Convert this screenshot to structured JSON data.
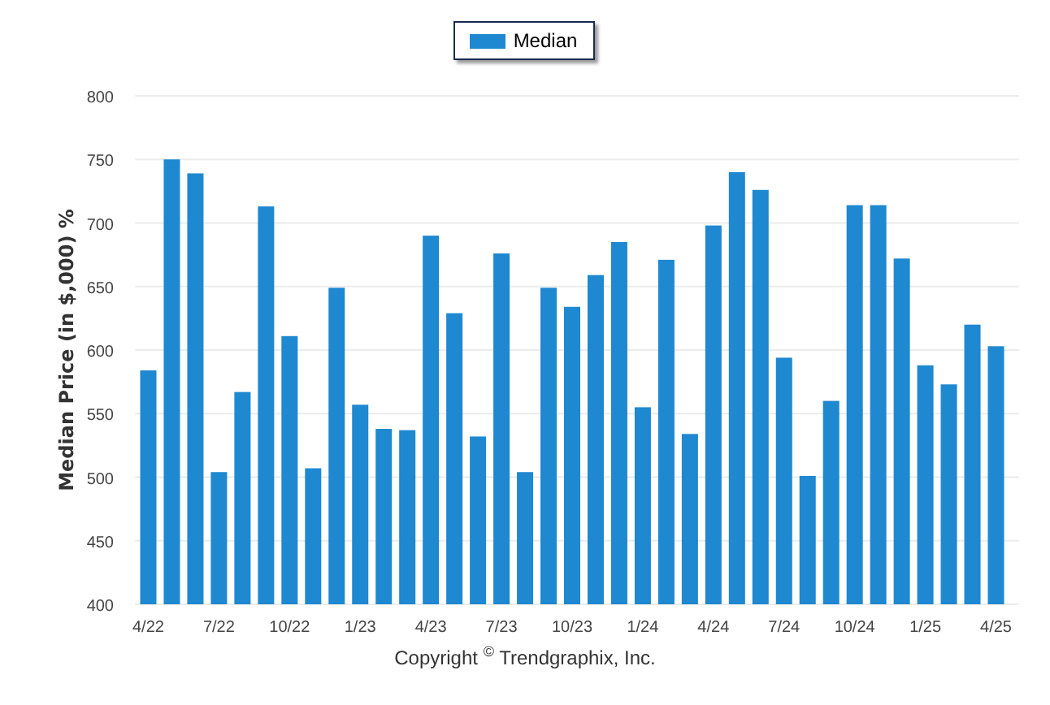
{
  "chart": {
    "chart_data": {
      "type": "bar",
      "ylabel": "Median Price (in $,000) %",
      "categories": [
        "4/22",
        null,
        null,
        "7/22",
        null,
        null,
        "10/22",
        null,
        null,
        "1/23",
        null,
        null,
        "4/23",
        null,
        null,
        "7/23",
        null,
        null,
        "10/23",
        null,
        null,
        "1/24",
        null,
        null,
        "4/24",
        null,
        null,
        "7/24",
        null,
        null,
        "10/24",
        null,
        null,
        "1/25",
        null,
        null,
        "4/25"
      ],
      "grid": true,
      "series": [
        {
          "name": "Median",
          "color": "#1e88d0",
          "values": [
            584,
            750,
            739,
            504,
            567,
            713,
            611,
            507,
            649,
            557,
            538,
            537,
            690,
            629,
            532,
            676,
            504,
            649,
            634,
            659,
            685,
            555,
            671,
            534,
            698,
            740,
            726,
            594,
            501,
            560,
            714,
            714,
            672,
            588,
            573,
            620,
            603
          ]
        }
      ],
      "ylim": [
        400,
        800
      ],
      "yticks": [
        400,
        450,
        500,
        550,
        600,
        650,
        700,
        750,
        800
      ]
    }
  },
  "footer": {
    "copyright": "Copyright $^{©}$ Trendgraphix, Inc."
  }
}
